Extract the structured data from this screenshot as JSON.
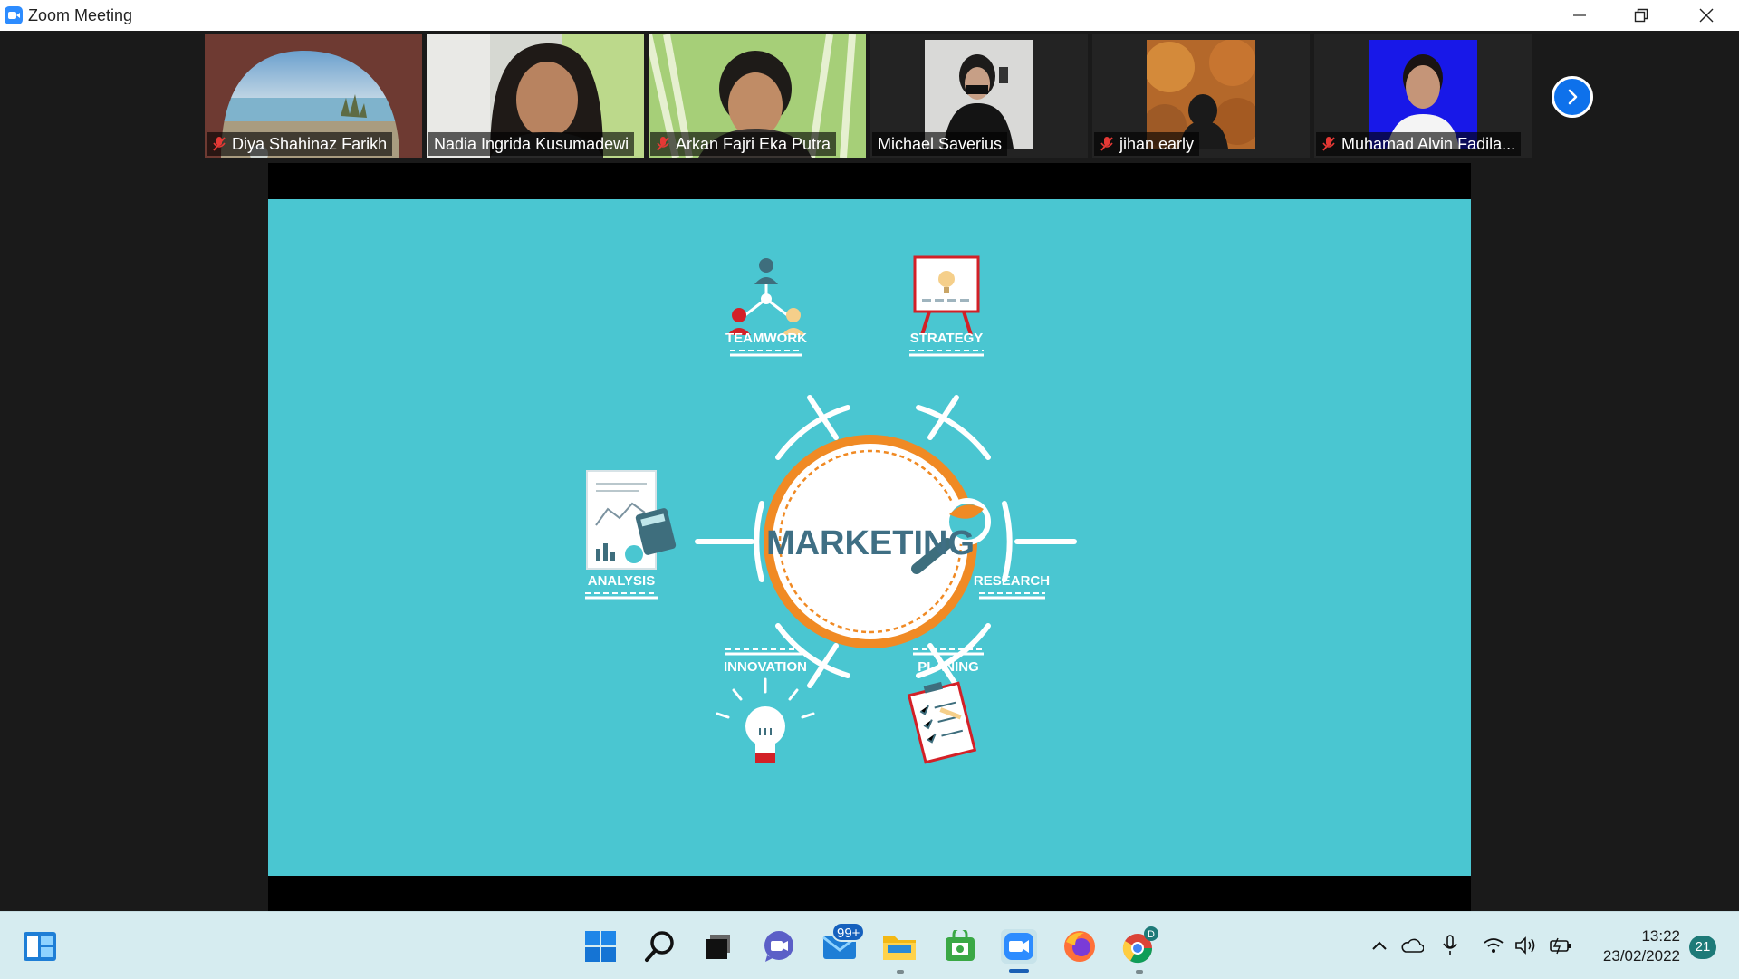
{
  "window": {
    "title": "Zoom Meeting",
    "controls": {
      "minimize": "—",
      "restore": "❐",
      "close": "✕"
    }
  },
  "gallery": {
    "participants": [
      {
        "name": "Diya Shahinaz Farikh",
        "muted": true,
        "active_speaker": false,
        "video": "beach-scene"
      },
      {
        "name": "Nadia Ingrida Kusumadewi",
        "muted": false,
        "active_speaker": true,
        "video": "person-camera"
      },
      {
        "name": "Arkan Fajri Eka Putra",
        "muted": true,
        "active_speaker": false,
        "video": "person-camera"
      },
      {
        "name": "Michael Saverius",
        "muted": false,
        "active_speaker": false,
        "video": "profile-photo"
      },
      {
        "name": "jihan early",
        "muted": true,
        "active_speaker": false,
        "video": "profile-photo"
      },
      {
        "name": "Muhamad Alvin Fadila...",
        "muted": true,
        "active_speaker": false,
        "video": "profile-photo"
      }
    ],
    "next_page_icon": "chevron-right-icon"
  },
  "slide": {
    "center_label": "MARKETING",
    "nodes": [
      {
        "label": "TEAMWORK",
        "icon": "team-network-icon"
      },
      {
        "label": "STRATEGY",
        "icon": "presentation-board-icon"
      },
      {
        "label": "ANALYSIS",
        "icon": "report-calculator-icon"
      },
      {
        "label": "RESEARCH",
        "icon": "magnifier-icon"
      },
      {
        "label": "INNOVATION",
        "icon": "lightbulb-icon"
      },
      {
        "label": "PLANING",
        "icon": "checklist-clipboard-icon"
      }
    ],
    "colors": {
      "background": "#4ac6d1",
      "accent": "#f08a24",
      "text": "#3f6f84"
    }
  },
  "taskbar": {
    "apps": [
      {
        "name": "widgets",
        "icon": "widgets-icon"
      },
      {
        "name": "start",
        "icon": "windows-start-icon"
      },
      {
        "name": "search",
        "icon": "search-icon"
      },
      {
        "name": "task-view",
        "icon": "task-view-icon"
      },
      {
        "name": "teams-chat",
        "icon": "chat-icon"
      },
      {
        "name": "mail",
        "icon": "mail-icon",
        "badge": "99+"
      },
      {
        "name": "file-explorer",
        "icon": "folder-icon"
      },
      {
        "name": "store",
        "icon": "store-icon"
      },
      {
        "name": "zoom",
        "icon": "zoom-icon"
      },
      {
        "name": "firefox",
        "icon": "firefox-icon"
      },
      {
        "name": "chrome",
        "icon": "chrome-icon",
        "profile_letter": "D"
      }
    ],
    "tray": {
      "icons": [
        "chevron-up-icon",
        "onedrive-icon",
        "microphone-icon",
        "wifi-icon",
        "volume-icon",
        "battery-icon"
      ],
      "time": "13:22",
      "date": "23/02/2022",
      "notifications": "21"
    }
  }
}
